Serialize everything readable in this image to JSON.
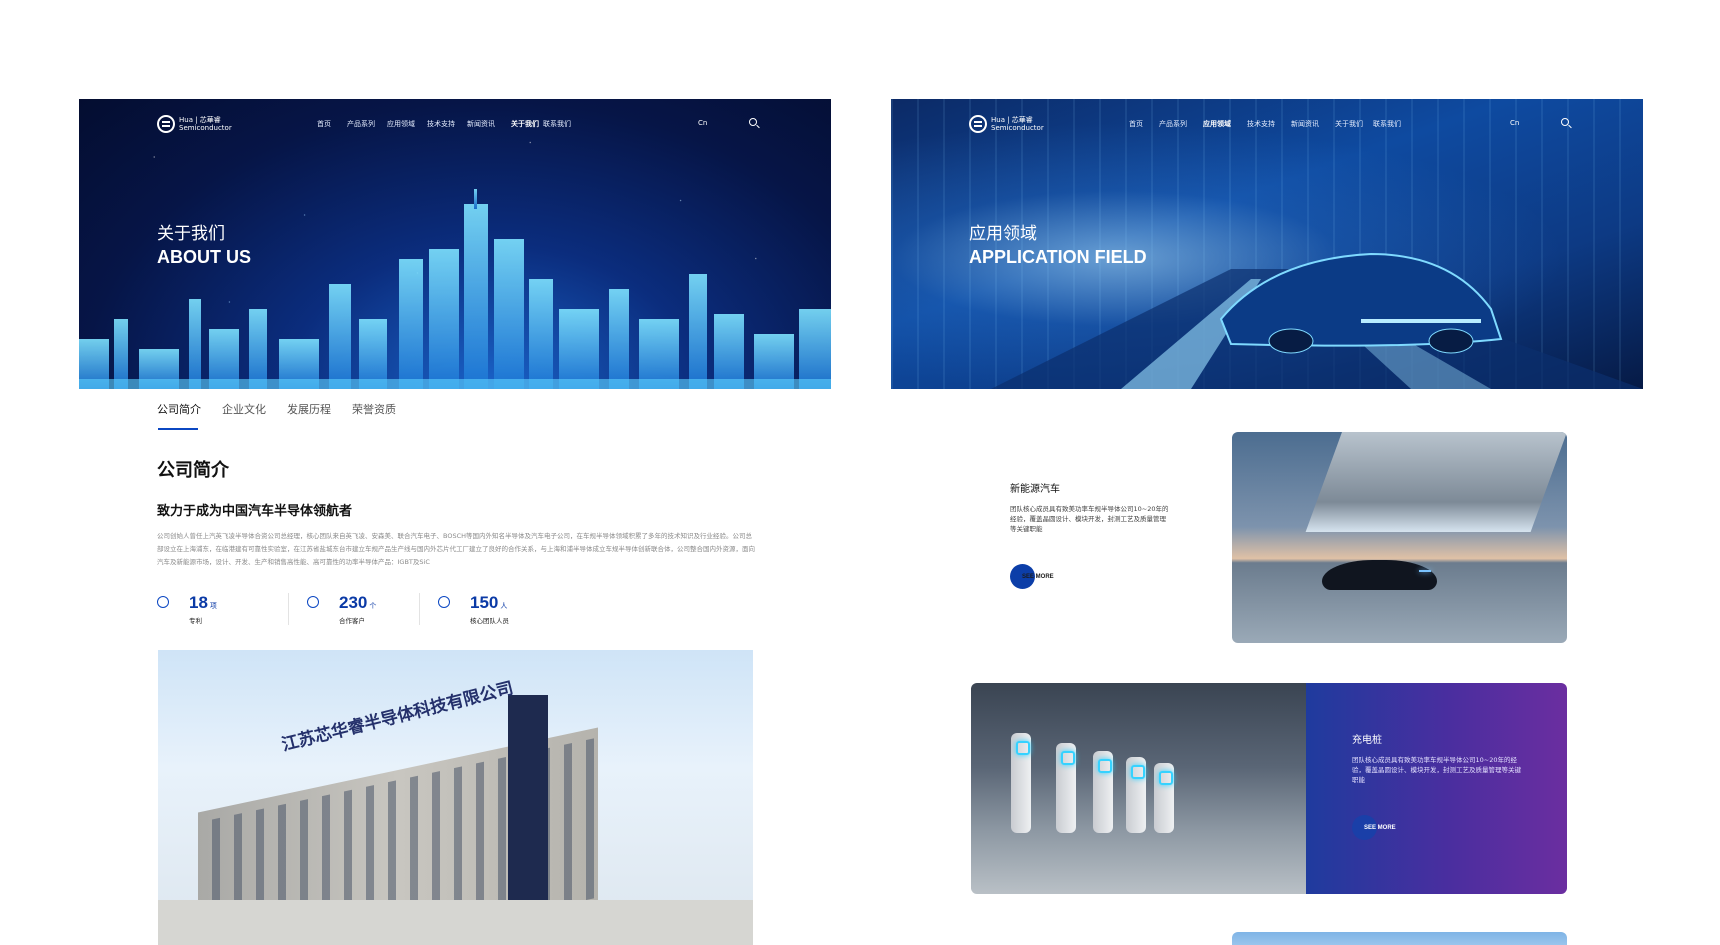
{
  "left_page": {
    "logo": {
      "line1": "Hua | 芯華睿",
      "line2": "Semiconductor"
    },
    "nav": [
      "首页",
      "产品系列",
      "应用领域",
      "技术支持",
      "新闻资讯",
      "关于我们",
      "联系我们"
    ],
    "lang": "Cn",
    "hero": {
      "cn": "关于我们",
      "en": "ABOUT US"
    },
    "tabs": [
      "公司简介",
      "企业文化",
      "发展历程",
      "荣誉资质"
    ],
    "section_title": "公司简介",
    "section_subtitle": "致力于成为中国汽车半导体领航者",
    "section_body": "公司创始人曾任上汽英飞凌半导体合资公司总经理，核心团队来自英飞凌、安森美、联合汽车电子、BOSCH等国内外知名半导体及汽车电子公司，在车规半导体领域积累了多年的技术知识及行业经验。公司总部设立在上海浦东，在临港建有可靠性实验室，在江苏省盐城东台市建立车规产品生产线与国内外芯片代工厂建立了良好的合作关系，与上海和浦半导体成立车规半导体创新联合体，公司整合国内外资源，面向汽车及新能源市场，设计、开发、生产和销售高性能、高可靠性的功率半导体产品：IGBT及SiC",
    "stats": [
      {
        "num": "18",
        "unit": "项",
        "label": "专利"
      },
      {
        "num": "230",
        "unit": "个",
        "label": "合作客户"
      },
      {
        "num": "150",
        "unit": "人",
        "label": "核心团队人员"
      }
    ],
    "building_sign": "江苏芯华睿半导体科技有限公司"
  },
  "right_page": {
    "logo": {
      "line1": "Hua | 芯華睿",
      "line2": "Semiconductor"
    },
    "nav": [
      "首页",
      "产品系列",
      "应用领域",
      "技术支持",
      "新闻资讯",
      "关于我们",
      "联系我们"
    ],
    "lang": "Cn",
    "hero": {
      "cn": "应用领域",
      "en": "APPLICATION FIELD"
    },
    "card_a": {
      "title": "新能源汽车",
      "desc": "团队核心成员具有致美功率车规半导体公司10~20年的经验，覆盖晶圆设计、模块开发，封测工艺及质量管理等关键职能",
      "more": "SEE MORE"
    },
    "card_b": {
      "title": "充电桩",
      "desc": "团队核心成员具有致美功率车规半导体公司10~20年的经验，覆盖晶圆设计、模块开发，封测工艺及质量管理等关键职能",
      "more": "SEE MORE"
    }
  }
}
